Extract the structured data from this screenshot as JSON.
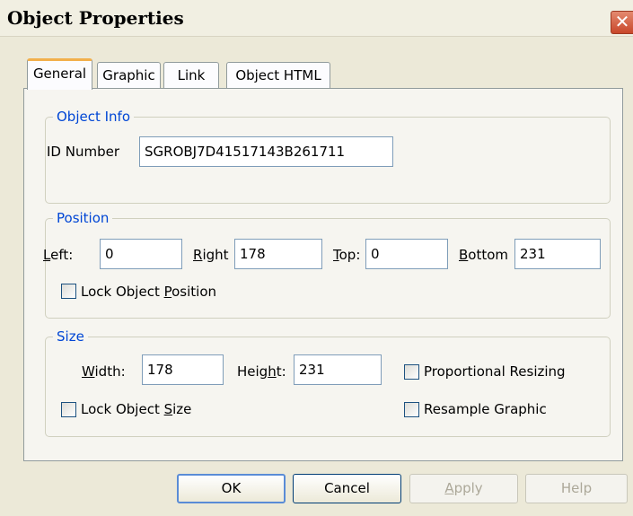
{
  "window": {
    "title": "Object Properties",
    "close_glyph": "✕",
    "close_icon": "close-icon"
  },
  "tabs": [
    {
      "label": "General",
      "active": true
    },
    {
      "label": "Graphic",
      "active": false
    },
    {
      "label": "Link",
      "active": false
    },
    {
      "label": "Object HTML",
      "active": false
    }
  ],
  "object_info": {
    "title": "Object Info",
    "id_label": "ID Number",
    "id_value": "SGROBJ7D41517143B261711"
  },
  "position": {
    "title": "Position",
    "left_label_u": "L",
    "left_label_rest": "eft:",
    "left_value": "0",
    "right_label_u": "R",
    "right_label_rest": "ight",
    "right_value": "178",
    "top_label_u": "T",
    "top_label_rest": "op:",
    "top_value": "0",
    "bottom_label_u": "B",
    "bottom_label_rest": "ottom",
    "bottom_value": "231",
    "lock_label_pre": "Lock Object ",
    "lock_label_u": "P",
    "lock_label_post": "osition",
    "lock_checked": false
  },
  "size": {
    "title": "Size",
    "width_label_u": "W",
    "width_label_rest": "idth:",
    "width_value": "178",
    "height_label_pre": "Heig",
    "height_label_u": "h",
    "height_label_post": "t:",
    "height_value": "231",
    "proportional_label": "Proportional Resizing",
    "proportional_checked": false,
    "lock_label_pre": "Lock Object ",
    "lock_label_u": "S",
    "lock_label_post": "ize",
    "lock_checked": false,
    "resample_label": "Resample Graphic",
    "resample_checked": false
  },
  "buttons": {
    "ok": "OK",
    "cancel": "Cancel",
    "apply_u": "A",
    "apply_rest": "pply",
    "help": "Help"
  },
  "colors": {
    "group_title": "#0046d5",
    "active_tab_accent": "#f2b04b",
    "close_button": "#c8472a"
  }
}
